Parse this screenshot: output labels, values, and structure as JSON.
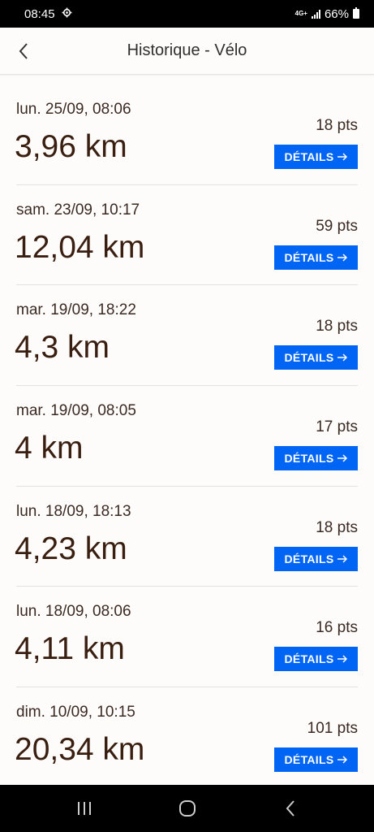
{
  "status_bar": {
    "time": "08:45",
    "network": "4G+",
    "battery": "66%"
  },
  "header": {
    "title": "Historique - Vélo"
  },
  "rides": [
    {
      "date": "lun. 25/09, 08:06",
      "distance": "3,96 km",
      "points": "18 pts",
      "details_label": "DÉTAILS"
    },
    {
      "date": "sam. 23/09, 10:17",
      "distance": "12,04 km",
      "points": "59 pts",
      "details_label": "DÉTAILS"
    },
    {
      "date": "mar. 19/09, 18:22",
      "distance": "4,3 km",
      "points": "18 pts",
      "details_label": "DÉTAILS"
    },
    {
      "date": "mar. 19/09, 08:05",
      "distance": "4 km",
      "points": "17 pts",
      "details_label": "DÉTAILS"
    },
    {
      "date": "lun. 18/09, 18:13",
      "distance": "4,23 km",
      "points": "18 pts",
      "details_label": "DÉTAILS"
    },
    {
      "date": "lun. 18/09, 08:06",
      "distance": "4,11 km",
      "points": "16 pts",
      "details_label": "DÉTAILS"
    },
    {
      "date": "dim. 10/09, 10:15",
      "distance": "20,34 km",
      "points": "101 pts",
      "details_label": "DÉTAILS"
    }
  ],
  "colors": {
    "accent": "#0064f5",
    "text_dark": "#3a1e10",
    "background": "#fdfcfb"
  },
  "icons": {
    "back": "back-chevron-icon",
    "details_arrow": "arrow-right-icon",
    "settings": "gear-icon",
    "nav_recent": "recent-apps-icon",
    "nav_home": "home-icon",
    "nav_back": "back-icon"
  }
}
